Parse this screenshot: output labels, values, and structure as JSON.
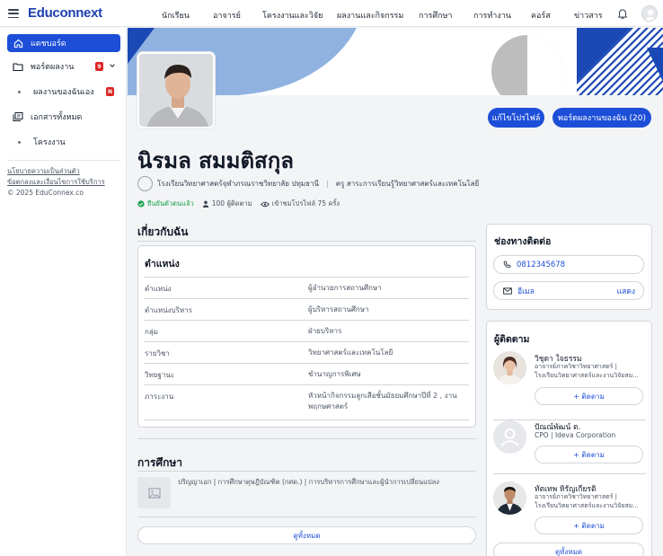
{
  "topnav": {
    "logo": "Educonnext",
    "items": [
      "นักเรียน",
      "อาจารย์",
      "โครงงานและวิจัย",
      "ผลงานและกิจกรรม",
      "การศึกษา",
      "การทำงาน",
      "คอร์ส",
      "ข่าวสาร"
    ]
  },
  "sidebar": {
    "dashboard": "แดชบอร์ด",
    "portfolio": "พอร์ตผลงาน",
    "portfolio_badge": "9",
    "my_work": "ผลงานของฉันเอง",
    "my_work_badge": "N",
    "all_docs": "เอกสารทั้งหมด",
    "projects": "โครงงาน",
    "privacy": "นโยบายความเป็นส่วนตัว",
    "terms": "ข้อตกลงและเงื่อนไขการใช้บริการ",
    "copyright": "© 2025 EduConnex.co"
  },
  "profile": {
    "edit_button": "แก้ไขโปรไฟล์",
    "portfolio_button": "พอร์ตผลงานของฉัน (20)",
    "name": "นิรมล สมมติสกุล",
    "school": "โรงเรียนวิทยาศาสตร์จุฬาภรณราชวิทยาลัย ปทุมธานี",
    "role": "ครู สาระการเรียนรู้วิทยาศาสตร์และเทคโนโลยี",
    "verified": "ยืนยันตัวตนแล้ว",
    "followers": "100 ผู้ติดตาม",
    "views": "เข้าชมโปรไฟล์ 75 ครั้ง"
  },
  "about": {
    "title": "เกี่ยวกับฉัน",
    "position_title": "ตำแหน่ง",
    "rows": [
      {
        "k": "ตำแหน่ง",
        "v": "ผู้อำนวยการสถานศึกษา"
      },
      {
        "k": "ตำแหน่งบริหาร",
        "v": "ผู้บริหารสถานศึกษา"
      },
      {
        "k": "กลุ่ม",
        "v": "ฝ่ายบริหาร"
      },
      {
        "k": "รายวิชา",
        "v": "วิทยาศาสตร์และเทคโนโลยี"
      },
      {
        "k": "วิทยฐานะ",
        "v": "ชำนาญการพิเศษ"
      },
      {
        "k": "ภาระงาน",
        "v": "หัวหน้ากิจกรรมลูกเสือชั้นมัธยมศึกษาปีที่ 2 , งานพฤกษศาสตร์"
      }
    ]
  },
  "education": {
    "title": "การศึกษา",
    "entry": "ปริญญาเอก | การศึกษาดุษฎีบัณฑิต (กศด.) | การบริหารการศึกษาและผู้นำการเปลี่ยนแปลง",
    "view_all": "ดูทั้งหมด"
  },
  "contact": {
    "title": "ช่องทางติดต่อ",
    "phone": "0812345678",
    "email_label": "อีเมล",
    "email_action": "แสดง"
  },
  "followers": {
    "title": "ผู้ติดตาม",
    "items": [
      {
        "name": "วิชุดา ใจธรรม",
        "line1": "อาจารย์ภาควิชาวิทยาศาสตร์ |",
        "line2": "โรงเรียนวิทยาศาสตร์และงานวิจัยสม...",
        "button": "+ ติดตาม"
      },
      {
        "name": "ปัณณ์พัฒน์ ต.",
        "line1": "CPO | Ideva Corporation",
        "line2": "",
        "button": "+ ติดตาม"
      },
      {
        "name": "ทัตเทพ หิรัญเกียรติ",
        "line1": "อาจารย์ภาควิชาวิทยาศาสตร์ |",
        "line2": "โรงเรียนวิทยาศาสตร์และงานวิจัยสม...",
        "button": "+ ติดตาม"
      }
    ],
    "view_all": "ดูทั้งหมด"
  },
  "colors": {
    "primary": "#1d4ed8",
    "cover_light": "#8fb2e0",
    "cover_dark": "#1a48b5",
    "cover_grey": "#bdbdbd"
  }
}
